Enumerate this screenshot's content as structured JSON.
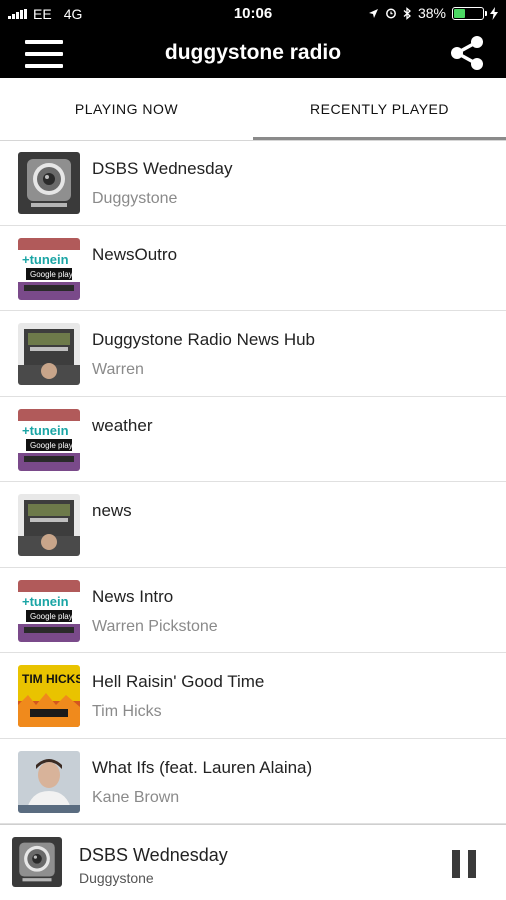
{
  "status_bar": {
    "carrier": "EE",
    "network": "4G",
    "time": "10:06",
    "battery": "38%",
    "battery_level": 0.38,
    "battery_color": "#4cd964"
  },
  "header": {
    "title": "duggystone radio",
    "menu_icon": "hamburger-menu-icon",
    "share_icon": "share-icon"
  },
  "tabs": [
    {
      "label": "PLAYING NOW",
      "active": false
    },
    {
      "label": "RECENTLY PLAYED",
      "active": true
    }
  ],
  "recently_played": [
    {
      "title": "DSBS Wednesday",
      "artist": "Duggystone",
      "art": "speaker"
    },
    {
      "title": "NewsOutro",
      "artist": "",
      "art": "tunein"
    },
    {
      "title": "Duggystone Radio News Hub",
      "artist": "Warren",
      "art": "news"
    },
    {
      "title": "weather",
      "artist": "",
      "art": "tunein"
    },
    {
      "title": "news",
      "artist": "",
      "art": "news"
    },
    {
      "title": "News Intro",
      "artist": "Warren Pickstone",
      "art": "tunein"
    },
    {
      "title": "Hell Raisin' Good Time",
      "artist": "Tim Hicks",
      "art": "tim"
    },
    {
      "title": "What Ifs (feat. Lauren Alaina)",
      "artist": "Kane Brown",
      "art": "kane"
    }
  ],
  "now_playing": {
    "title": "DSBS Wednesday",
    "artist": "Duggystone",
    "control_icon": "pause-icon"
  },
  "colors": {
    "header_bg": "#000000",
    "active_tab_indicator": "#8a8a8a",
    "subtitle_text": "#8a8a8a"
  }
}
